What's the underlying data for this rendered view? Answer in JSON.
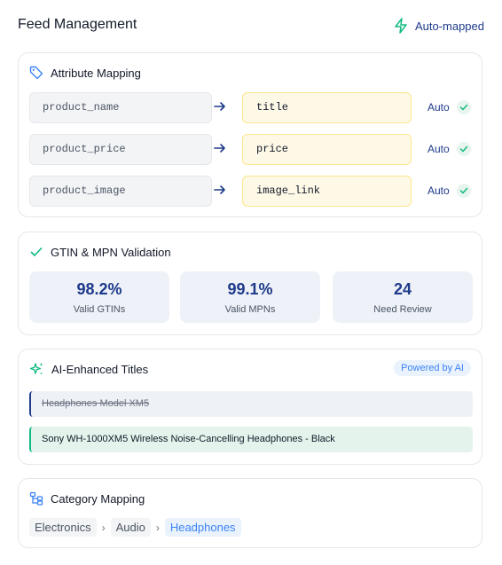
{
  "header": {
    "title": "Feed Management",
    "status": "Auto-mapped"
  },
  "attribute_mapping": {
    "title": "Attribute Mapping",
    "rows": [
      {
        "source": "product_name",
        "target": "title",
        "status": "Auto"
      },
      {
        "source": "product_price",
        "target": "price",
        "status": "Auto"
      },
      {
        "source": "product_image",
        "target": "image_link",
        "status": "Auto"
      }
    ]
  },
  "validation": {
    "title": "GTIN & MPN Validation",
    "stats": [
      {
        "value": "98.2%",
        "label": "Valid GTINs"
      },
      {
        "value": "99.1%",
        "label": "Valid MPNs"
      },
      {
        "value": "24",
        "label": "Need Review"
      }
    ]
  },
  "ai_titles": {
    "title": "AI-Enhanced Titles",
    "badge": "Powered by AI",
    "original": "Headphones Model XM5",
    "enhanced": "Sony WH-1000XM5 Wireless Noise-Cancelling Headphones - Black"
  },
  "category_mapping": {
    "title": "Category Mapping",
    "path": [
      "Electronics",
      "Audio",
      "Headphones"
    ],
    "separator": "›"
  },
  "colors": {
    "accent": "#1e3a8a",
    "success": "#10b981",
    "link": "#3b82f6"
  }
}
